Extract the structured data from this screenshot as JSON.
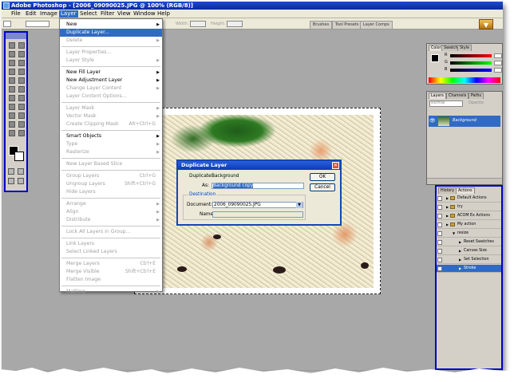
{
  "window": {
    "title": "Adobe Photoshop - [2006_09090025.JPG @ 100% (RGB/8)]"
  },
  "menubar": [
    "File",
    "Edit",
    "Image",
    "Layer",
    "Select",
    "Filter",
    "View",
    "Window",
    "Help"
  ],
  "options_bar": {
    "width_label": "Width:",
    "height_label": "Height:"
  },
  "well_tabs": [
    "Brushes",
    "Tool Presets",
    "Layer Comps"
  ],
  "layer_menu": {
    "groups": [
      [
        {
          "label": "New",
          "submenu": true
        },
        {
          "label": "Duplicate Layer...",
          "highlighted": true
        },
        {
          "label": "Delete",
          "submenu": true,
          "disabled": true
        }
      ],
      [
        {
          "label": "Layer Properties...",
          "disabled": true
        },
        {
          "label": "Layer Style",
          "submenu": true,
          "disabled": true
        }
      ],
      [
        {
          "label": "New Fill Layer",
          "submenu": true
        },
        {
          "label": "New Adjustment Layer",
          "submenu": true
        },
        {
          "label": "Change Layer Content",
          "submenu": true,
          "disabled": true
        },
        {
          "label": "Layer Content Options...",
          "disabled": true
        }
      ],
      [
        {
          "label": "Layer Mask",
          "submenu": true,
          "disabled": true
        },
        {
          "label": "Vector Mask",
          "submenu": true,
          "disabled": true
        },
        {
          "label": "Create Clipping Mask",
          "shortcut": "Alt+Ctrl+G",
          "disabled": true
        }
      ],
      [
        {
          "label": "Smart Objects",
          "submenu": true
        },
        {
          "label": "Type",
          "submenu": true,
          "disabled": true
        },
        {
          "label": "Rasterize",
          "submenu": true,
          "disabled": true
        }
      ],
      [
        {
          "label": "New Layer Based Slice",
          "disabled": true
        }
      ],
      [
        {
          "label": "Group Layers",
          "shortcut": "Ctrl+G",
          "disabled": true
        },
        {
          "label": "Ungroup Layers",
          "shortcut": "Shift+Ctrl+G",
          "disabled": true
        },
        {
          "label": "Hide Layers",
          "disabled": true
        }
      ],
      [
        {
          "label": "Arrange",
          "submenu": true,
          "disabled": true
        },
        {
          "label": "Align",
          "submenu": true,
          "disabled": true
        },
        {
          "label": "Distribute",
          "submenu": true,
          "disabled": true
        }
      ],
      [
        {
          "label": "Lock All Layers in Group...",
          "disabled": true
        }
      ],
      [
        {
          "label": "Link Layers",
          "disabled": true
        },
        {
          "label": "Select Linked Layers",
          "disabled": true
        }
      ],
      [
        {
          "label": "Merge Layers",
          "shortcut": "Ctrl+E",
          "disabled": true
        },
        {
          "label": "Merge Visible",
          "shortcut": "Shift+Ctrl+E",
          "disabled": true
        },
        {
          "label": "Flatten Image",
          "disabled": true
        }
      ],
      [
        {
          "label": "Matting",
          "submenu": true,
          "disabled": true
        }
      ]
    ]
  },
  "dialog": {
    "title": "Duplicate Layer",
    "duplicate_label": "Duplicate:",
    "duplicate_value": "Background",
    "as_label": "As:",
    "as_value": "Background copy",
    "ok": "OK",
    "cancel": "Cancel",
    "destination_label": "Destination",
    "document_label": "Document:",
    "document_value": "2006_09090025.JPG",
    "name_label": "Name:",
    "name_value": ""
  },
  "color_panel": {
    "tabs": [
      "Color",
      "Swatches",
      "Style"
    ],
    "channels": [
      "R",
      "G",
      "B"
    ]
  },
  "layers_panel": {
    "tabs": [
      "Layers",
      "Channels",
      "Paths"
    ],
    "blend_mode": "Normal",
    "opacity_label": "Opacity:",
    "layer_name": "Background"
  },
  "actions_panel": {
    "tabs": [
      "History",
      "Actions"
    ],
    "rows": [
      {
        "label": "Default Actions",
        "indent": 0,
        "type": "set"
      },
      {
        "label": "try",
        "indent": 0,
        "type": "set"
      },
      {
        "label": "ACOM Ex Actions",
        "indent": 0,
        "type": "set"
      },
      {
        "label": "My action",
        "indent": 0,
        "type": "set"
      },
      {
        "label": "resize",
        "indent": 1,
        "type": "action"
      },
      {
        "label": "Reset Swatches",
        "indent": 2,
        "type": "step"
      },
      {
        "label": "Canvas Size",
        "indent": 2,
        "type": "step"
      },
      {
        "label": "Set Selection",
        "indent": 2,
        "type": "step"
      },
      {
        "label": "Stroke",
        "indent": 2,
        "type": "step",
        "selected": true
      }
    ]
  }
}
